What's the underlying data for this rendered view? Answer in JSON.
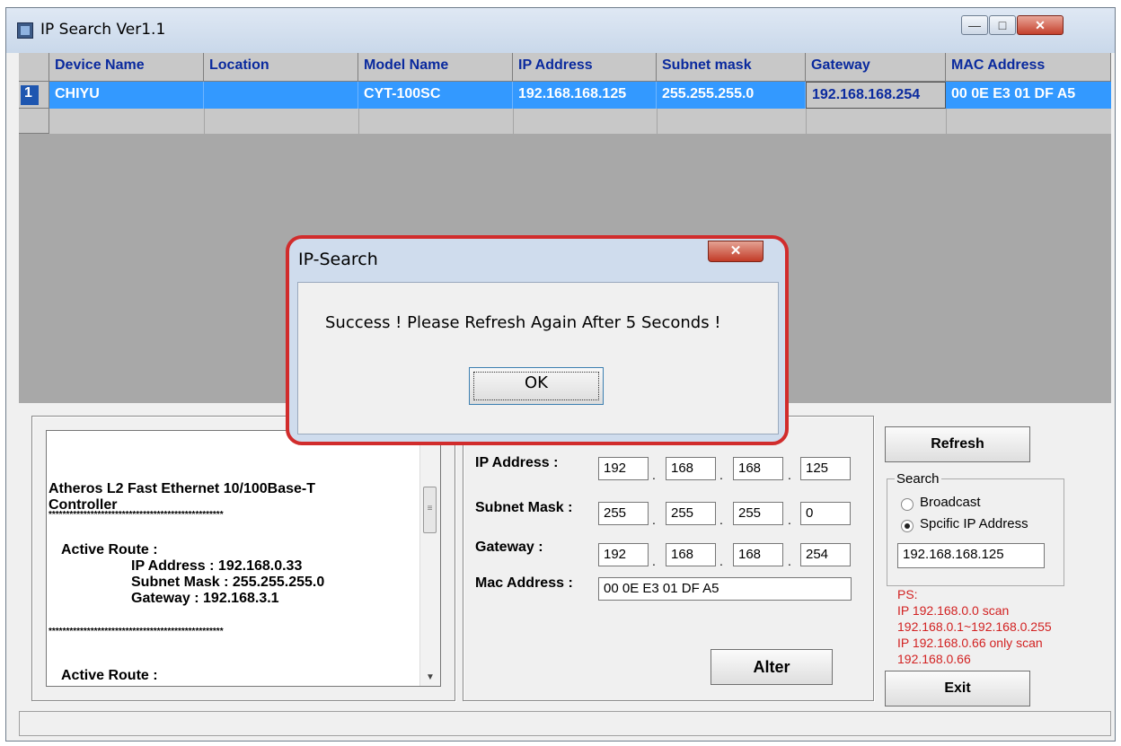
{
  "window": {
    "title": "IP Search Ver1.1"
  },
  "grid": {
    "columns": [
      "Device Name",
      "Location",
      "Model Name",
      "IP Address",
      "Subnet mask",
      "Gateway",
      "MAC Address"
    ],
    "rows": [
      {
        "num": "1",
        "device_name": "CHIYU",
        "location": "",
        "model_name": "CYT-100SC",
        "ip_address": "192.168.168.125",
        "subnet_mask": "255.255.255.0",
        "gateway": "192.168.168.254",
        "mac_address": "00 0E E3 01 DF A5"
      }
    ]
  },
  "info_text": {
    "adapter": "Atheros L2 Fast Ethernet 10/100Base-T",
    "adapter2": "Controller",
    "separator": "**************************************************",
    "active_route": "Active Route :",
    "ip_line": "IP Address : 192.168.0.33",
    "mask_line": "Subnet Mask : 255.255.255.0",
    "gw_line": "Gateway : 192.168.3.1",
    "active_route2": "Active Route :"
  },
  "form": {
    "ip_label": "IP Address :",
    "ip": [
      "192",
      "168",
      "168",
      "125"
    ],
    "mask_label": "Subnet Mask :",
    "mask": [
      "255",
      "255",
      "255",
      "0"
    ],
    "gw_label": "Gateway :",
    "gw": [
      "192",
      "168",
      "168",
      "254"
    ],
    "mac_label": "Mac Address :",
    "mac": "00 0E E3 01 DF A5",
    "alter": "Alter"
  },
  "right": {
    "refresh": "Refresh",
    "search_legend": "Search",
    "broadcast": "Broadcast",
    "specific": "Spcific IP Address",
    "specific_value": "192.168.168.125",
    "ps": [
      "PS:",
      "IP 192.168.0.0 scan",
      "192.168.0.1~192.168.0.255",
      "IP 192.168.0.66 only scan",
      "192.168.0.66"
    ],
    "exit": "Exit"
  },
  "dialog": {
    "title": "IP-Search",
    "message": "Success ! Please Refresh Again After 5 Seconds !",
    "ok": "OK"
  },
  "colors": {
    "selection": "#3399ff",
    "header_text": "#0a2a9e",
    "ps_text": "#d22222",
    "dialog_highlight": "#d12c2c"
  }
}
